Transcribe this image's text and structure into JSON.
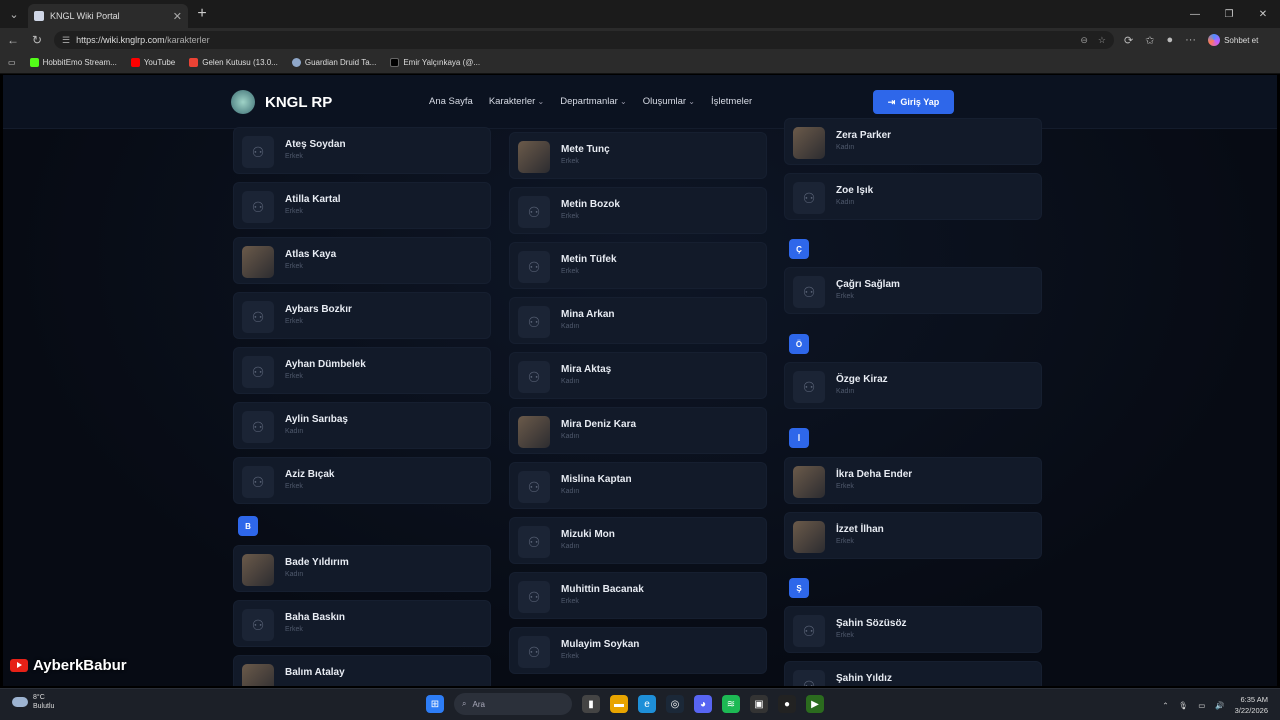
{
  "browser": {
    "tab_title": "KNGL Wiki Portal",
    "tab_close": "✕",
    "new_tab": "+",
    "url_host": "https://wiki.knglrp.com",
    "url_path": "/karakterler",
    "chat_label": "Sohbet et",
    "bookmarks": [
      "HobbitEmo Stream...",
      "YouTube",
      "Gelen Kutusu (13.0...",
      "Guardian Druid Ta...",
      "Emir Yalçınkaya (@..."
    ]
  },
  "site": {
    "logo": "KNGL RP",
    "menu": [
      "Ana Sayfa",
      "Karakterler",
      "Departmanlar",
      "Oluşumlar",
      "İşletmeler"
    ],
    "login": "Giriş Yap"
  },
  "columns": {
    "left": [
      {
        "name": "Ateş Soydan",
        "gender": "Erkek"
      },
      {
        "name": "Atilla Kartal",
        "gender": "Erkek"
      },
      {
        "name": "Atlas Kaya",
        "gender": "Erkek",
        "photo": true
      },
      {
        "name": "Aybars Bozkır",
        "gender": "Erkek"
      },
      {
        "name": "Ayhan Dümbelek",
        "gender": "Erkek"
      },
      {
        "name": "Aylin Sarıbaş",
        "gender": "Kadın"
      },
      {
        "name": "Aziz Bıçak",
        "gender": "Erkek"
      }
    ],
    "left_letter": "B",
    "left_b": [
      {
        "name": "Bade Yıldırım",
        "gender": "Kadın",
        "photo": true
      },
      {
        "name": "Baha Baskın",
        "gender": "Erkek"
      },
      {
        "name": "Balım Atalay",
        "gender": "",
        "photo": true
      }
    ],
    "middle": [
      {
        "name": "Mete Tunç",
        "gender": "Erkek",
        "photo": true
      },
      {
        "name": "Metin Bozok",
        "gender": "Erkek"
      },
      {
        "name": "Metin Tüfek",
        "gender": "Erkek"
      },
      {
        "name": "Mina Arkan",
        "gender": "Kadın"
      },
      {
        "name": "Mira Aktaş",
        "gender": "Kadın"
      },
      {
        "name": "Mira Deniz Kara",
        "gender": "Kadın",
        "photo": true
      },
      {
        "name": "Mislina Kaptan",
        "gender": "Kadın"
      },
      {
        "name": "Mizuki Mon",
        "gender": "Kadın"
      },
      {
        "name": "Muhittin Bacanak",
        "gender": "Erkek"
      },
      {
        "name": "Mulayim Soykan",
        "gender": "Erkek"
      }
    ],
    "right_top": [
      {
        "name": "Zera Parker",
        "gender": "Kadın",
        "photo": true
      },
      {
        "name": "Zoe Işık",
        "gender": "Kadın"
      }
    ],
    "letter_c": "Ç",
    "card_c": {
      "name": "Çağrı Sağlam",
      "gender": "Erkek"
    },
    "letter_o": "Ö",
    "card_o": {
      "name": "Özge Kiraz",
      "gender": "Kadın"
    },
    "letter_i": "İ",
    "cards_i": [
      {
        "name": "İkra Deha Ender",
        "gender": "Erkek",
        "photo": true
      },
      {
        "name": "İzzet İlhan",
        "gender": "Erkek",
        "photo": true
      }
    ],
    "letter_s": "Ş",
    "cards_s": [
      {
        "name": "Şahin Sözüsöz",
        "gender": "Erkek"
      },
      {
        "name": "Şahin Yıldız",
        "gender": ""
      }
    ]
  },
  "watermark": "AyberkBabur",
  "taskbar": {
    "temp": "8°C",
    "weather": "Bulutlu",
    "search": "Ara",
    "time": "6:35 AM",
    "date": "3/22/2026"
  }
}
